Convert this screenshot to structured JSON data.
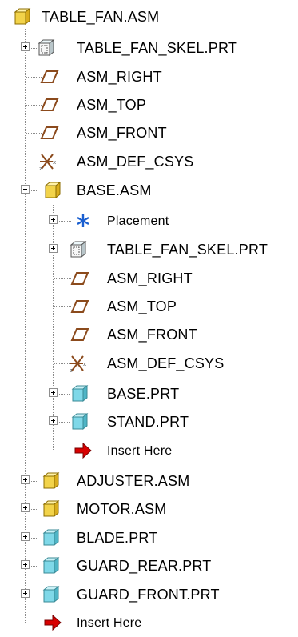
{
  "tree": {
    "root": {
      "label": "TABLE_FAN.ASM",
      "icon": "assembly-icon"
    },
    "items": [
      {
        "label": "TABLE_FAN_SKEL.PRT",
        "icon": "skeleton-part-icon",
        "toggle": "+"
      },
      {
        "label": "ASM_RIGHT",
        "icon": "datum-plane-icon"
      },
      {
        "label": "ASM_TOP",
        "icon": "datum-plane-icon"
      },
      {
        "label": "ASM_FRONT",
        "icon": "datum-plane-icon"
      },
      {
        "label": "ASM_DEF_CSYS",
        "icon": "coordinate-system-icon"
      },
      {
        "label": "BASE.ASM",
        "icon": "assembly-icon",
        "toggle": "-",
        "children": [
          {
            "label": "Placement",
            "icon": "placement-icon",
            "toggle": "+"
          },
          {
            "label": "TABLE_FAN_SKEL.PRT",
            "icon": "skeleton-part-icon",
            "toggle": "+"
          },
          {
            "label": "ASM_RIGHT",
            "icon": "datum-plane-icon"
          },
          {
            "label": "ASM_TOP",
            "icon": "datum-plane-icon"
          },
          {
            "label": "ASM_FRONT",
            "icon": "datum-plane-icon"
          },
          {
            "label": "ASM_DEF_CSYS",
            "icon": "coordinate-system-icon"
          },
          {
            "label": "BASE.PRT",
            "icon": "part-icon",
            "toggle": "+"
          },
          {
            "label": "STAND.PRT",
            "icon": "part-icon",
            "toggle": "+"
          },
          {
            "label": "Insert Here",
            "icon": "insert-arrow-icon"
          }
        ]
      },
      {
        "label": "ADJUSTER.ASM",
        "icon": "assembly-icon",
        "toggle": "+"
      },
      {
        "label": "MOTOR.ASM",
        "icon": "assembly-icon",
        "toggle": "+"
      },
      {
        "label": "BLADE.PRT",
        "icon": "part-icon",
        "toggle": "+"
      },
      {
        "label": "GUARD_REAR.PRT",
        "icon": "part-icon",
        "toggle": "+"
      },
      {
        "label": "GUARD_FRONT.PRT",
        "icon": "part-icon",
        "toggle": "+"
      },
      {
        "label": "Insert Here",
        "icon": "insert-arrow-icon"
      }
    ]
  },
  "colors": {
    "assembly": "#f2d34a",
    "part": "#7fd8e8",
    "datum": "#8b4a1c",
    "insert": "#d80000",
    "placement": "#1a5fd0"
  }
}
